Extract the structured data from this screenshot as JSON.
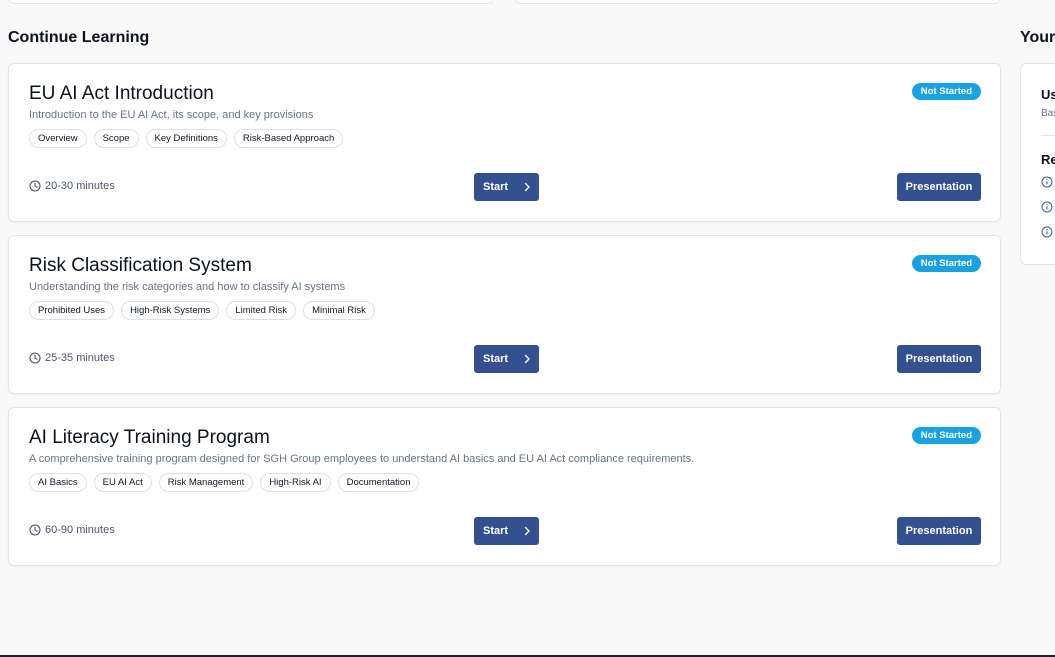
{
  "section": {
    "title": "Continue Learning"
  },
  "right_panel": {
    "title": "Your",
    "heading": "Us",
    "subtext": "Bas",
    "heading2": "Re"
  },
  "courses": [
    {
      "title": "EU AI Act Introduction",
      "description": "Introduction to the EU AI Act, its scope, and key provisions",
      "status": "Not Started",
      "tags": [
        "Overview",
        "Scope",
        "Key Definitions",
        "Risk-Based Approach"
      ],
      "duration": "20-30 minutes",
      "start_label": "Start",
      "presentation_label": "Presentation"
    },
    {
      "title": "Risk Classification System",
      "description": "Understanding the risk categories and how to classify AI systems",
      "status": "Not Started",
      "tags": [
        "Prohibited Uses",
        "High-Risk Systems",
        "Limited Risk",
        "Minimal Risk"
      ],
      "duration": "25-35 minutes",
      "start_label": "Start",
      "presentation_label": "Presentation"
    },
    {
      "title": "AI Literacy Training Program",
      "description": "A comprehensive training program designed for SGH Group employees to understand AI basics and EU AI Act compliance requirements.",
      "status": "Not Started",
      "tags": [
        "AI Basics",
        "EU AI Act",
        "Risk Management",
        "High-Risk AI",
        "Documentation"
      ],
      "duration": "60-90 minutes",
      "start_label": "Start",
      "presentation_label": "Presentation"
    }
  ],
  "icons": {
    "clock": "clock-icon",
    "chevron": "chevron-right-icon",
    "info": "info-icon"
  },
  "colors": {
    "primary_button": "#34508f",
    "status_badge": "#1aa1e0",
    "background": "#f9f9fa"
  }
}
